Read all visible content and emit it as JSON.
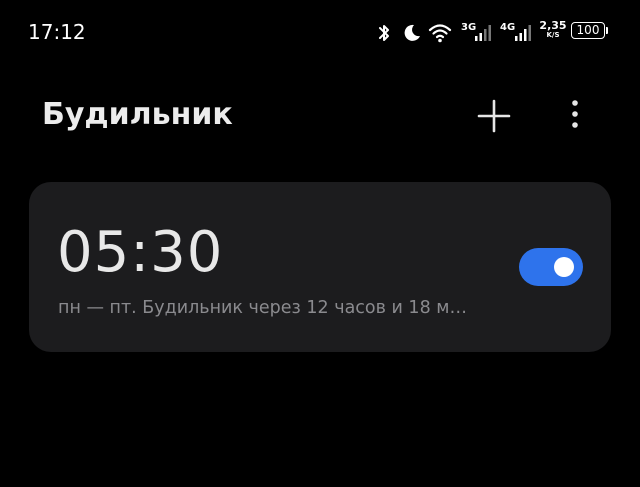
{
  "status_bar": {
    "time": "17:12",
    "network_1": "3G",
    "network_2": "4G",
    "speed_value": "2,35",
    "speed_unit": "K/S",
    "battery": "100"
  },
  "header": {
    "title": "Будильник",
    "add_icon": "plus-icon",
    "more_icon": "more-vertical-icon"
  },
  "alarms": [
    {
      "time": "05:30",
      "description": "пн — пт. Будильник через 12 часов и 18 м…",
      "enabled": true
    }
  ],
  "colors": {
    "background": "#000000",
    "card": "#1c1c1e",
    "accent": "#2e73ec",
    "secondary_text": "#8a8a8e"
  }
}
